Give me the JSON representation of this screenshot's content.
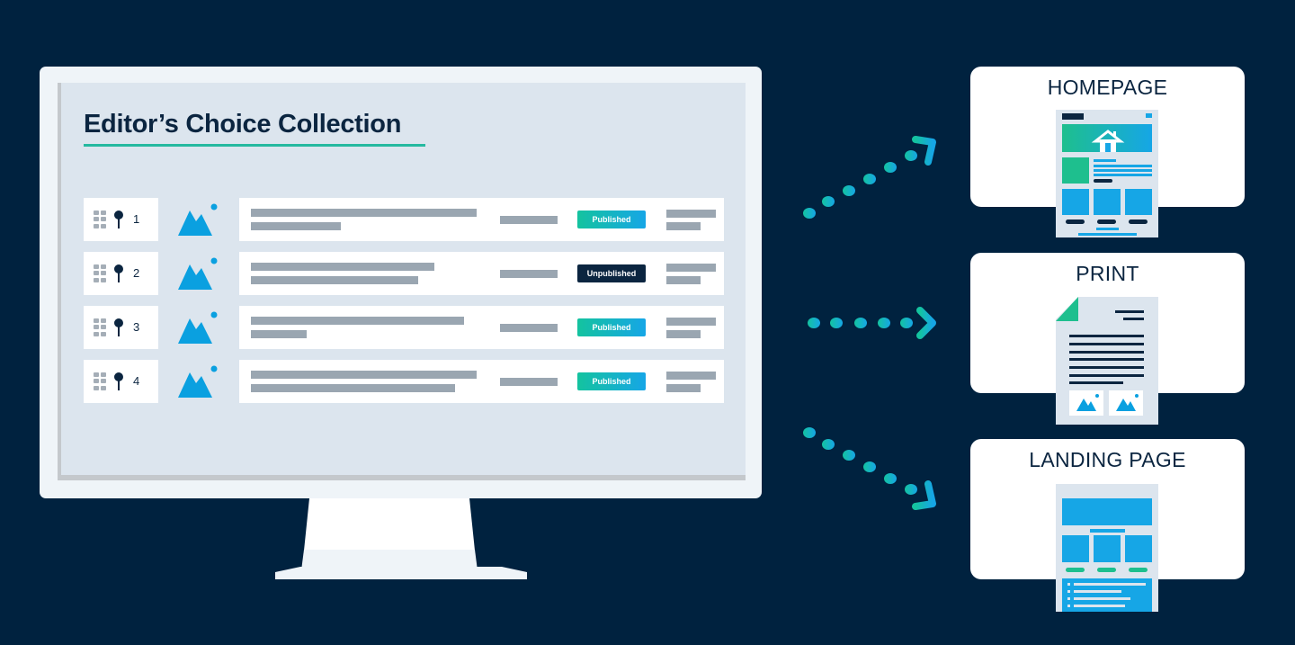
{
  "colors": {
    "background": "#00223f",
    "navy": "#0b2540",
    "teal": "#14c39f",
    "blue": "#16a6e6",
    "bar_gray": "#9aa6b1",
    "screen": "#dce5ee"
  },
  "monitor": {
    "collection_title": "Editor’s Choice Collection",
    "rows": [
      {
        "position": "1",
        "status": "Published",
        "status_type": "published"
      },
      {
        "position": "2",
        "status": "Unpublished",
        "status_type": "unpublished"
      },
      {
        "position": "3",
        "status": "Published",
        "status_type": "published"
      },
      {
        "position": "4",
        "status": "Published",
        "status_type": "published"
      }
    ],
    "row_icons": [
      "drag-handle-icon",
      "pin-icon",
      "image-placeholder-icon"
    ]
  },
  "destinations": [
    {
      "label": "HOMEPAGE",
      "icon": "homepage-layout-icon"
    },
    {
      "label": "PRINT",
      "icon": "print-document-icon"
    },
    {
      "label": "LANDING PAGE",
      "icon": "landing-page-layout-icon"
    }
  ],
  "arrows": [
    "arrow-to-homepage",
    "arrow-to-print",
    "arrow-to-landing-page"
  ]
}
